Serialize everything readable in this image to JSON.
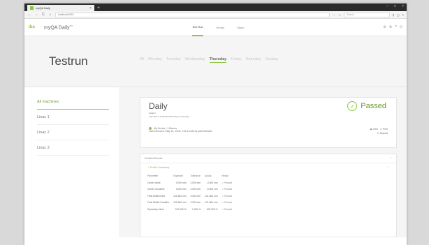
{
  "browser": {
    "tab_title": "myQA Daily",
    "tab_close": "×",
    "tab_add": "+",
    "win_min": "–",
    "win_max": "□",
    "win_close": "×",
    "url": "localhost:8181",
    "search_placeholder": "Search",
    "back": "←",
    "forward": "→",
    "reload": "C",
    "home": "⌂"
  },
  "app": {
    "logo": "iba",
    "title": "myQA Daily",
    "title_sup": "2.0",
    "tabs": [
      {
        "label": "Test Run",
        "active": true
      },
      {
        "label": "Trends",
        "active": false
      },
      {
        "label": "Setup",
        "active": false
      }
    ],
    "header_icons": [
      "gear-icon",
      "settings-icon",
      "help-icon",
      "logout-icon"
    ]
  },
  "page": {
    "title": "Testrun",
    "days": [
      {
        "label": "All",
        "active": false
      },
      {
        "label": "Monday",
        "active": false
      },
      {
        "label": "Tuesday",
        "active": false
      },
      {
        "label": "Wednesday",
        "active": false
      },
      {
        "label": "Thursday",
        "active": true
      },
      {
        "label": "Friday",
        "active": false
      },
      {
        "label": "Saturday",
        "active": false
      },
      {
        "label": "Sunday",
        "active": false
      }
    ]
  },
  "sidebar": {
    "items": [
      {
        "label": "All machines",
        "active": true
      },
      {
        "label": "Linac 1",
        "active": false
      },
      {
        "label": "Linac 2",
        "active": false
      },
      {
        "label": "Linac 3",
        "active": false
      }
    ]
  },
  "card": {
    "title": "Daily",
    "subtitle": "Linac 2",
    "description": "This task is scheduled Monday to Thursday",
    "status": "Passed",
    "device": "My Device",
    "beams": "1 Beams",
    "last_executed": "Last executed: May 10, 2018, 4:01:18 AM by Administrator",
    "view_label": "View",
    "print_label": "Print",
    "repeat_label": "Repeat"
  },
  "results": {
    "title": "Detailed Results",
    "section": "Profile Constancy",
    "columns": [
      "Parameter",
      "Expected",
      "Tolerance",
      "Actual",
      "Result"
    ],
    "rows": [
      [
        "Center Inline",
        "0.000 mm",
        "2.000 mm",
        "-0.000 mm",
        "Passed"
      ],
      [
        "Center Crossline",
        "0.000 mm",
        "2.000 mm",
        "-0.000 mm",
        "Passed"
      ],
      [
        "Field Width Inline",
        "121.600 mm",
        "2.000 mm",
        "121.564 mm",
        "Passed"
      ],
      [
        "Field Width Crossline",
        "121.600 mm",
        "2.000 mm",
        "121.564 mm",
        "Passed"
      ],
      [
        "Symmetry Inline",
        "100.000 %",
        "1.000 %",
        "100.000 %",
        "Passed"
      ]
    ]
  }
}
